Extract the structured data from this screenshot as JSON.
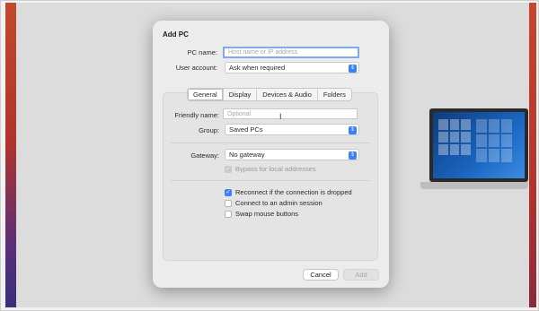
{
  "dialog": {
    "title": "Add PC",
    "pc_name": {
      "label": "PC name:",
      "placeholder": "Host name or IP address",
      "value": ""
    },
    "user_account": {
      "label": "User account:",
      "value": "Ask when required"
    },
    "tabs": [
      {
        "label": "General",
        "selected": true
      },
      {
        "label": "Display",
        "selected": false
      },
      {
        "label": "Devices & Audio",
        "selected": false
      },
      {
        "label": "Folders",
        "selected": false
      }
    ],
    "friendly_name": {
      "label": "Friendly name:",
      "placeholder": "Optional",
      "value": ""
    },
    "group": {
      "label": "Group:",
      "value": "Saved PCs"
    },
    "gateway": {
      "label": "Gateway:",
      "value": "No gateway"
    },
    "bypass_local": {
      "label": "Bypass for local addresses",
      "checked": true,
      "enabled": false
    },
    "options": [
      {
        "label": "Reconnect if the connection is dropped",
        "checked": true
      },
      {
        "label": "Connect to an admin session",
        "checked": false
      },
      {
        "label": "Swap mouse buttons",
        "checked": false
      }
    ],
    "buttons": {
      "cancel": "Cancel",
      "add": "Add"
    }
  },
  "icons": {
    "chevron": "chevron-updown-icon",
    "checkmark": "checkmark-icon",
    "cursor": "ibeam-cursor-icon"
  },
  "colors": {
    "accent": "#3b82f6",
    "focus_ring": "#7eaaf0",
    "dialog_bg": "#ececec"
  }
}
